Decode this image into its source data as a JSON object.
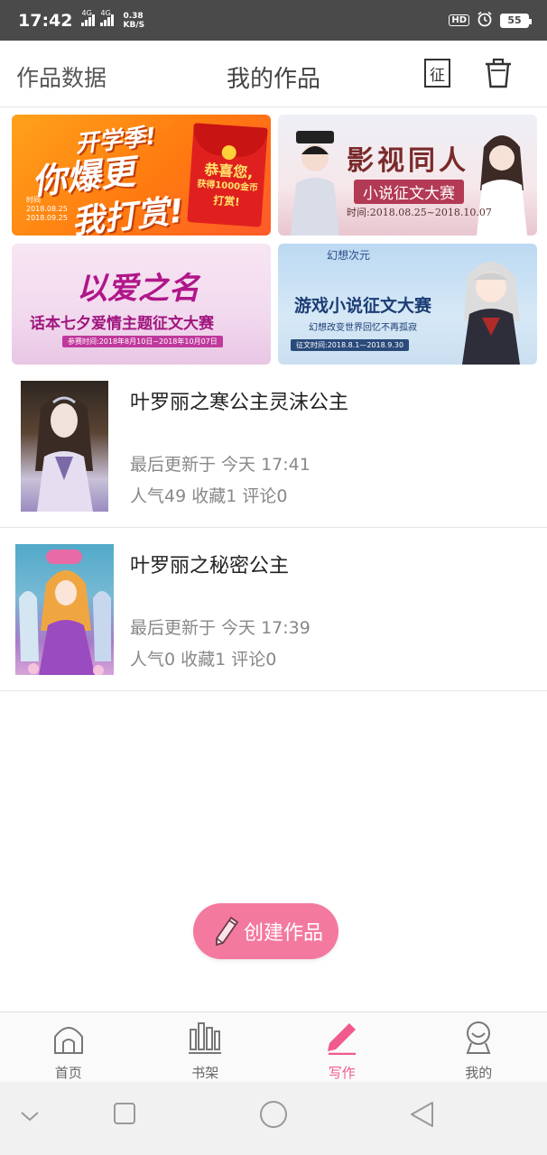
{
  "status_bar": {
    "time": "17:42",
    "network_1": "4G",
    "network_2": "4G",
    "speed_value": "0.38",
    "speed_unit": "KB/S",
    "hd_label": "HD",
    "battery": "55"
  },
  "header": {
    "left_label": "作品数据",
    "title": "我的作品",
    "contest_icon_char": "征"
  },
  "banners": [
    {
      "title_line1": "开学季!",
      "title_line2": "你爆更",
      "title_line3": "我打赏!",
      "time_label": "时间",
      "time_start": "2018.08.25",
      "time_end": "2018.09.25",
      "envelope_line1": "恭喜您,",
      "envelope_line2": "获得1000金币",
      "envelope_line3": "打赏!"
    },
    {
      "title": "影视同人",
      "subtitle": "小说征文大赛",
      "time": "时间:2018.08.25~2018.10.07"
    },
    {
      "title": "以爱之名",
      "subtitle": "话本七夕爱情主题征文大赛",
      "time": "参赛时间:2018年8月10日~2018年10月07日"
    },
    {
      "logo": "幻想次元",
      "title": "游戏小说征文大赛",
      "subtitle": "幻想改变世界回忆不再孤寂",
      "time": "征文时间:2018.8.1—2018.9.30"
    }
  ],
  "works": [
    {
      "title": "叶罗丽之寒公主灵沫公主",
      "updated": "最后更新于 今天 17:41",
      "stats": "人气49  收藏1  评论0"
    },
    {
      "title": "叶罗丽之秘密公主",
      "updated": "最后更新于 今天 17:39",
      "stats": "人气0  收藏1  评论0"
    }
  ],
  "create_button": {
    "label": "创建作品"
  },
  "tabs": [
    {
      "label": "首页",
      "icon": "home-icon",
      "active": false
    },
    {
      "label": "书架",
      "icon": "bookshelf-icon",
      "active": false
    },
    {
      "label": "写作",
      "icon": "pen-icon",
      "active": true
    },
    {
      "label": "我的",
      "icon": "profile-icon",
      "active": false
    }
  ],
  "colors": {
    "accent": "#f05a8c",
    "create_button": "#f4799e",
    "status_bar": "#4a4a4a"
  }
}
